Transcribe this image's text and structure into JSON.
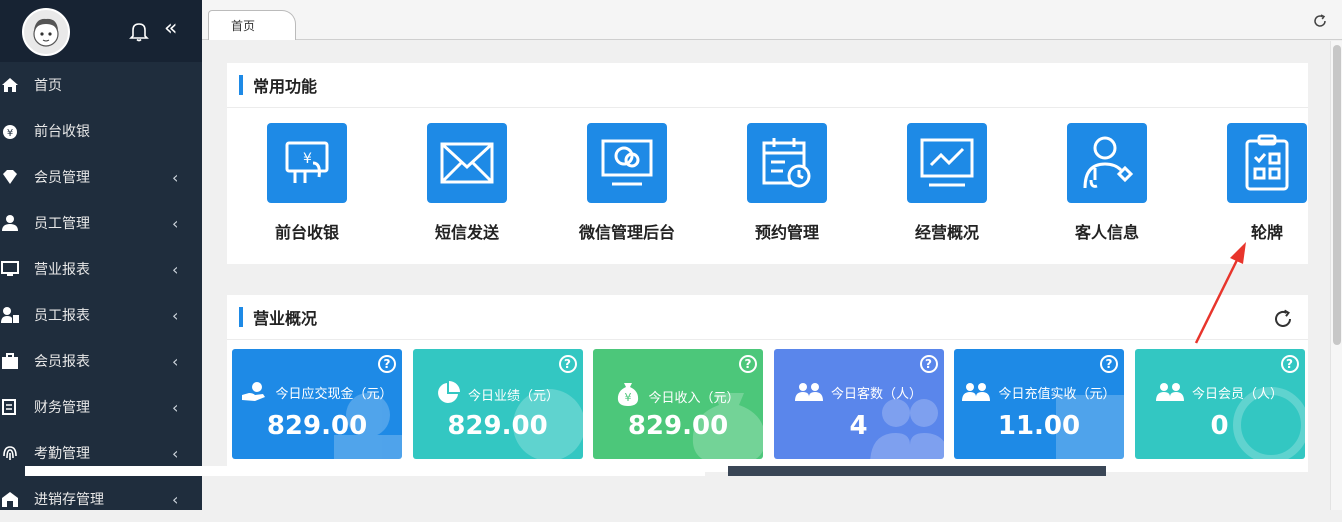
{
  "sidebar": {
    "items": [
      {
        "label": "首页",
        "icon": "home-icon",
        "has_submenu": false
      },
      {
        "label": "前台收银",
        "icon": "money-bag-icon",
        "has_submenu": false
      },
      {
        "label": "会员管理",
        "icon": "diamond-icon",
        "has_submenu": true
      },
      {
        "label": "员工管理",
        "icon": "user-icon",
        "has_submenu": true
      },
      {
        "label": "营业报表",
        "icon": "monitor-icon",
        "has_submenu": true
      },
      {
        "label": "员工报表",
        "icon": "user-report-icon",
        "has_submenu": true
      },
      {
        "label": "会员报表",
        "icon": "member-report-icon",
        "has_submenu": true
      },
      {
        "label": "财务管理",
        "icon": "finance-icon",
        "has_submenu": true
      },
      {
        "label": "考勤管理",
        "icon": "fingerprint-icon",
        "has_submenu": true
      },
      {
        "label": "进销存管理",
        "icon": "warehouse-icon",
        "has_submenu": true
      }
    ],
    "arrow_glyph": "‹",
    "collapse_glyph": "«"
  },
  "tabs": [
    {
      "label": "首页"
    }
  ],
  "functions": {
    "title": "常用功能",
    "items": [
      {
        "label": "前台收银",
        "icon": "cashier-icon"
      },
      {
        "label": "短信发送",
        "icon": "mail-icon"
      },
      {
        "label": "微信管理后台",
        "icon": "wechat-icon"
      },
      {
        "label": "预约管理",
        "icon": "calendar-icon"
      },
      {
        "label": "经营概况",
        "icon": "chart-icon"
      },
      {
        "label": "客人信息",
        "icon": "guest-icon"
      },
      {
        "label": "轮牌",
        "icon": "clipboard-icon"
      }
    ]
  },
  "overview": {
    "title": "营业概况",
    "cards": [
      {
        "label": "今日应交现金（元）",
        "value": "829.00",
        "color": "#1e8ae6",
        "icon": "cash-hand-icon"
      },
      {
        "label": "今日业绩（元）",
        "value": "829.00",
        "color": "#33c7c2",
        "icon": "pie-icon"
      },
      {
        "label": "今日收入（元）",
        "value": "829.00",
        "color": "#4cc77a",
        "icon": "yen-bag-icon"
      },
      {
        "label": "今日客数（人）",
        "value": "4",
        "color": "#5a86eb",
        "icon": "people-icon"
      },
      {
        "label": "今日充值实收（元）",
        "value": "11.00",
        "color": "#1e8ae6",
        "icon": "people-icon"
      },
      {
        "label": "今日会员（人）",
        "value": "0",
        "color": "#33c7c2",
        "icon": "people-icon"
      }
    ],
    "help_glyph": "?"
  },
  "colors": {
    "accent": "#1e8ae6",
    "sidebar": "#1f2d3d",
    "annotation_arrow": "#e8352c"
  }
}
